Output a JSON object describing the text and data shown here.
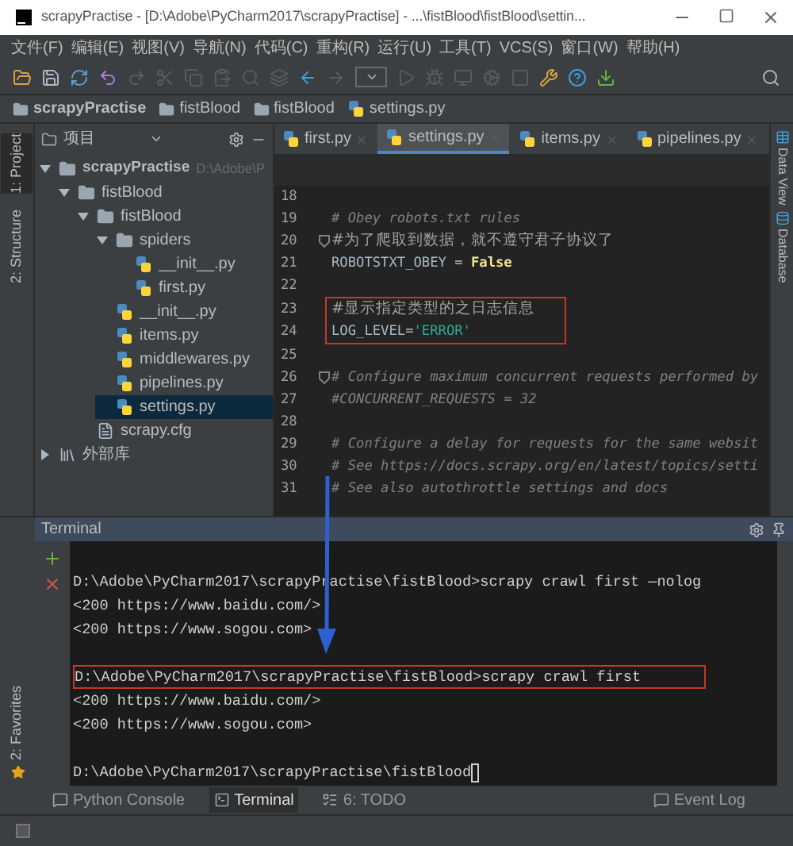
{
  "window": {
    "title": "scrapyPractise - [D:\\Adobe\\PyCharm2017\\scrapyPractise] - ...\\fistBlood\\fistBlood\\settin..."
  },
  "menu": [
    "文件(F)",
    "编辑(E)",
    "视图(V)",
    "导航(N)",
    "代码(C)",
    "重构(R)",
    "运行(U)",
    "工具(T)",
    "VCS(S)",
    "窗口(W)",
    "帮助(H)"
  ],
  "breadcrumb": [
    {
      "label": "scrapyPractise",
      "kind": "root"
    },
    {
      "label": "fistBlood",
      "kind": "folder"
    },
    {
      "label": "fistBlood",
      "kind": "folder"
    },
    {
      "label": "settings.py",
      "kind": "python"
    }
  ],
  "left_strip": [
    "1: Project",
    "2: Structure"
  ],
  "project_panel": {
    "title": "项目",
    "tree": [
      {
        "label": "scrapyPractise",
        "path": "D:\\Adobe\\P",
        "kind": "folder",
        "expanded": true,
        "selected": false,
        "children": [
          {
            "label": "fistBlood",
            "kind": "folder",
            "expanded": true,
            "selected": false,
            "children": [
              {
                "label": "fistBlood",
                "kind": "folder",
                "expanded": true,
                "selected": false,
                "children": [
                  {
                    "label": "spiders",
                    "kind": "folder",
                    "expanded": true,
                    "selected": false,
                    "children": [
                      {
                        "label": "__init__.py",
                        "kind": "python",
                        "selected": false
                      },
                      {
                        "label": "first.py",
                        "kind": "python",
                        "selected": false
                      }
                    ]
                  },
                  {
                    "label": "__init__.py",
                    "kind": "python",
                    "selected": false
                  },
                  {
                    "label": "items.py",
                    "kind": "python",
                    "selected": false
                  },
                  {
                    "label": "middlewares.py",
                    "kind": "python",
                    "selected": false
                  },
                  {
                    "label": "pipelines.py",
                    "kind": "python",
                    "selected": false
                  },
                  {
                    "label": "settings.py",
                    "kind": "python",
                    "selected": true
                  }
                ]
              },
              {
                "label": "scrapy.cfg",
                "kind": "config",
                "selected": false
              }
            ]
          }
        ]
      },
      {
        "label": "外部库",
        "kind": "library",
        "expanded": false,
        "selected": false
      }
    ]
  },
  "editor_tabs": [
    {
      "label": "first.py",
      "selected": false
    },
    {
      "label": "settings.py",
      "selected": true
    },
    {
      "label": "items.py",
      "selected": false
    },
    {
      "label": "pipelines.py",
      "selected": false
    }
  ],
  "code_lines": [
    {
      "number": "18"
    },
    {
      "number": "19",
      "segments": [
        {
          "kind": "comment",
          "text": "# Obey robots.txt rules"
        }
      ]
    },
    {
      "number": "20",
      "fold": true,
      "segments": [
        {
          "kind": "note",
          "text": "#为了爬取到数据，就不遵守君子协议了"
        }
      ]
    },
    {
      "number": "21",
      "segments": [
        {
          "kind": "plain",
          "text": "ROBOTSTXT_OBEY = "
        },
        {
          "kind": "keyword",
          "text": "False"
        }
      ]
    },
    {
      "number": "22"
    },
    {
      "number": "23",
      "boxed": true,
      "segments": [
        {
          "kind": "note",
          "text": "#显示指定类型的之日志信息"
        }
      ]
    },
    {
      "number": "24",
      "boxed": true,
      "segments": [
        {
          "kind": "plain",
          "text": "LOG_LEVEL="
        },
        {
          "kind": "string",
          "text": "'ERROR'"
        }
      ]
    },
    {
      "number": "25"
    },
    {
      "number": "26",
      "fold": true,
      "segments": [
        {
          "kind": "comment",
          "text": "# Configure maximum concurrent requests performed by"
        }
      ]
    },
    {
      "number": "27",
      "segments": [
        {
          "kind": "comment",
          "text": "#CONCURRENT_REQUESTS = 32"
        }
      ]
    },
    {
      "number": "28"
    },
    {
      "number": "29",
      "segments": [
        {
          "kind": "comment",
          "text": "# Configure a delay for requests for the same websit"
        }
      ]
    },
    {
      "number": "30",
      "segments": [
        {
          "kind": "comment",
          "text": "# See https://docs.scrapy.org/en/latest/topics/setti"
        }
      ]
    },
    {
      "number": "31",
      "segments": [
        {
          "kind": "comment",
          "text": "# See also autothrottle settings and docs"
        }
      ]
    }
  ],
  "right_strip": [
    "Data View",
    "Database"
  ],
  "terminal": {
    "title": "Terminal",
    "lines": [
      {
        "kind": "line",
        "text": "D:\\Adobe\\PyCharm2017\\scrapyPractise\\fistBlood>scrapy crawl first —nolog",
        "boxed": false
      },
      {
        "kind": "line",
        "text": "<200 https://www.baidu.com/>",
        "boxed": false
      },
      {
        "kind": "line",
        "text": "<200 https://www.sogou.com>",
        "boxed": false
      },
      {
        "kind": "blank"
      },
      {
        "kind": "line",
        "text": "D:\\Adobe\\PyCharm2017\\scrapyPractise\\fistBlood>scrapy crawl first",
        "boxed": true
      },
      {
        "kind": "line",
        "text": "<200 https://www.baidu.com/>",
        "boxed": false
      },
      {
        "kind": "line",
        "text": "<200 https://www.sogou.com>",
        "boxed": false
      },
      {
        "kind": "blank"
      },
      {
        "kind": "line",
        "text": "D:\\Adobe\\PyCharm2017\\scrapyPractise\\fistBlood",
        "boxed": false,
        "cursor": true
      }
    ]
  },
  "favorites_strip": "2: Favorites",
  "bottom_tabs": [
    {
      "label": "Python Console",
      "kind": "console",
      "selected": false
    },
    {
      "label": "Terminal",
      "kind": "terminal",
      "selected": true
    },
    {
      "label": "6: TODO",
      "kind": "todo",
      "selected": false
    }
  ],
  "event_log": "Event Log"
}
